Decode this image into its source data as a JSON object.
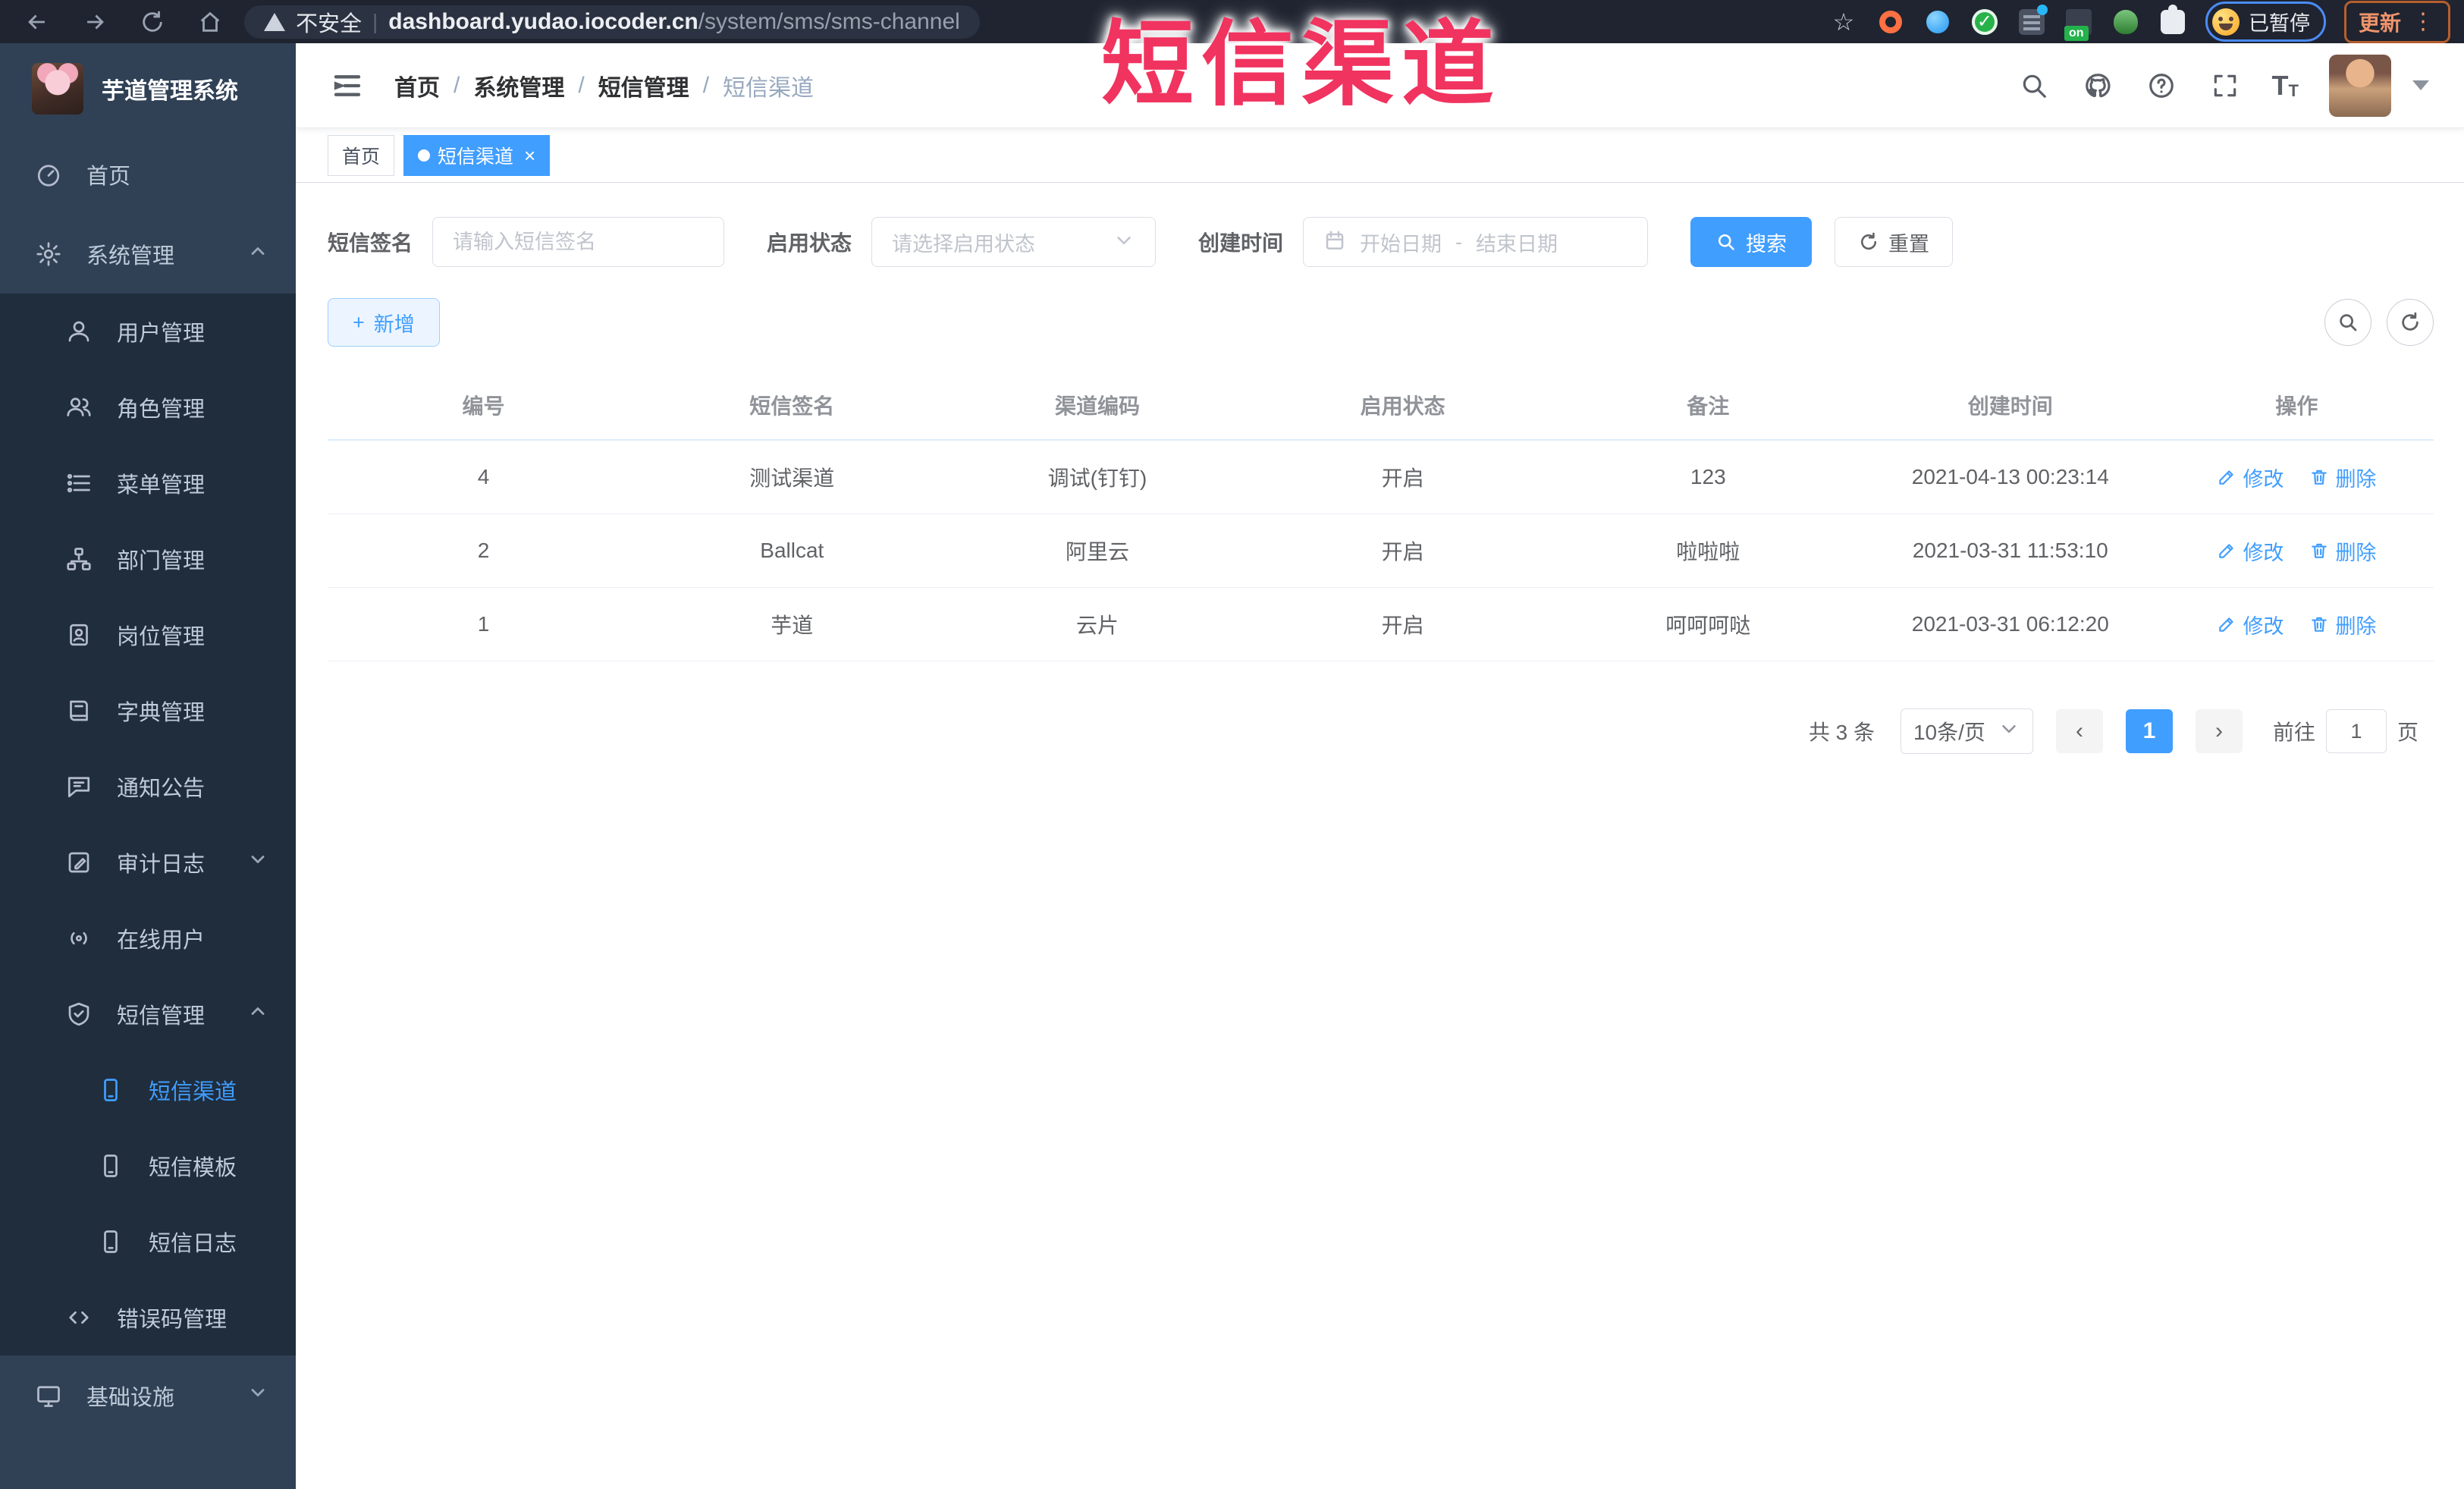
{
  "overlay_title": "短信渠道",
  "icons": {
    "slash": "/",
    "star": "☆",
    "more": "⋮",
    "on": "on",
    "font_big": "T",
    "font_small": "T",
    "question": "?",
    "plus": "+",
    "close": "×",
    "prev": "‹",
    "next": "›",
    "divider": "|",
    "check": "✓"
  },
  "browser": {
    "security_label": "不安全",
    "url_host": "dashboard.yudao.iocoder.cn",
    "url_path": "/system/sms/sms-channel",
    "paused_label": "已暂停",
    "update_label": "更新"
  },
  "sidebar": {
    "logo_title": "芋道管理系统",
    "items": [
      {
        "label": "首页"
      },
      {
        "label": "系统管理"
      },
      {
        "label": "用户管理"
      },
      {
        "label": "角色管理"
      },
      {
        "label": "菜单管理"
      },
      {
        "label": "部门管理"
      },
      {
        "label": "岗位管理"
      },
      {
        "label": "字典管理"
      },
      {
        "label": "通知公告"
      },
      {
        "label": "审计日志"
      },
      {
        "label": "在线用户"
      },
      {
        "label": "短信管理"
      },
      {
        "label": "短信渠道"
      },
      {
        "label": "短信模板"
      },
      {
        "label": "短信日志"
      },
      {
        "label": "错误码管理"
      },
      {
        "label": "基础设施"
      }
    ]
  },
  "breadcrumb": [
    "首页",
    "系统管理",
    "短信管理",
    "短信渠道"
  ],
  "tags": {
    "home": "首页",
    "active": "短信渠道"
  },
  "filters": {
    "sign_label": "短信签名",
    "sign_placeholder": "请输入短信签名",
    "status_label": "启用状态",
    "status_placeholder": "请选择启用状态",
    "date_label": "创建时间",
    "date_start": "开始日期",
    "date_sep": "-",
    "date_end": "结束日期",
    "search_label": "搜索",
    "reset_label": "重置"
  },
  "toolbar": {
    "add_label": "新增"
  },
  "table": {
    "headers": [
      "编号",
      "短信签名",
      "渠道编码",
      "启用状态",
      "备注",
      "创建时间",
      "操作"
    ],
    "edit_label": "修改",
    "delete_label": "删除",
    "rows": [
      {
        "no": "4",
        "sign": "测试渠道",
        "code": "调试(钉钉)",
        "status": "开启",
        "remark": "123",
        "created": "2021-04-13 00:23:14"
      },
      {
        "no": "2",
        "sign": "Ballcat",
        "code": "阿里云",
        "status": "开启",
        "remark": "啦啦啦",
        "created": "2021-03-31 11:53:10"
      },
      {
        "no": "1",
        "sign": "芋道",
        "code": "云片",
        "status": "开启",
        "remark": "呵呵呵哒",
        "created": "2021-03-31 06:12:20"
      }
    ]
  },
  "pagination": {
    "total": "共 3 条",
    "page_size": "10条/页",
    "page": "1",
    "goto_label": "前往",
    "goto_value": "1",
    "page_unit": "页"
  }
}
